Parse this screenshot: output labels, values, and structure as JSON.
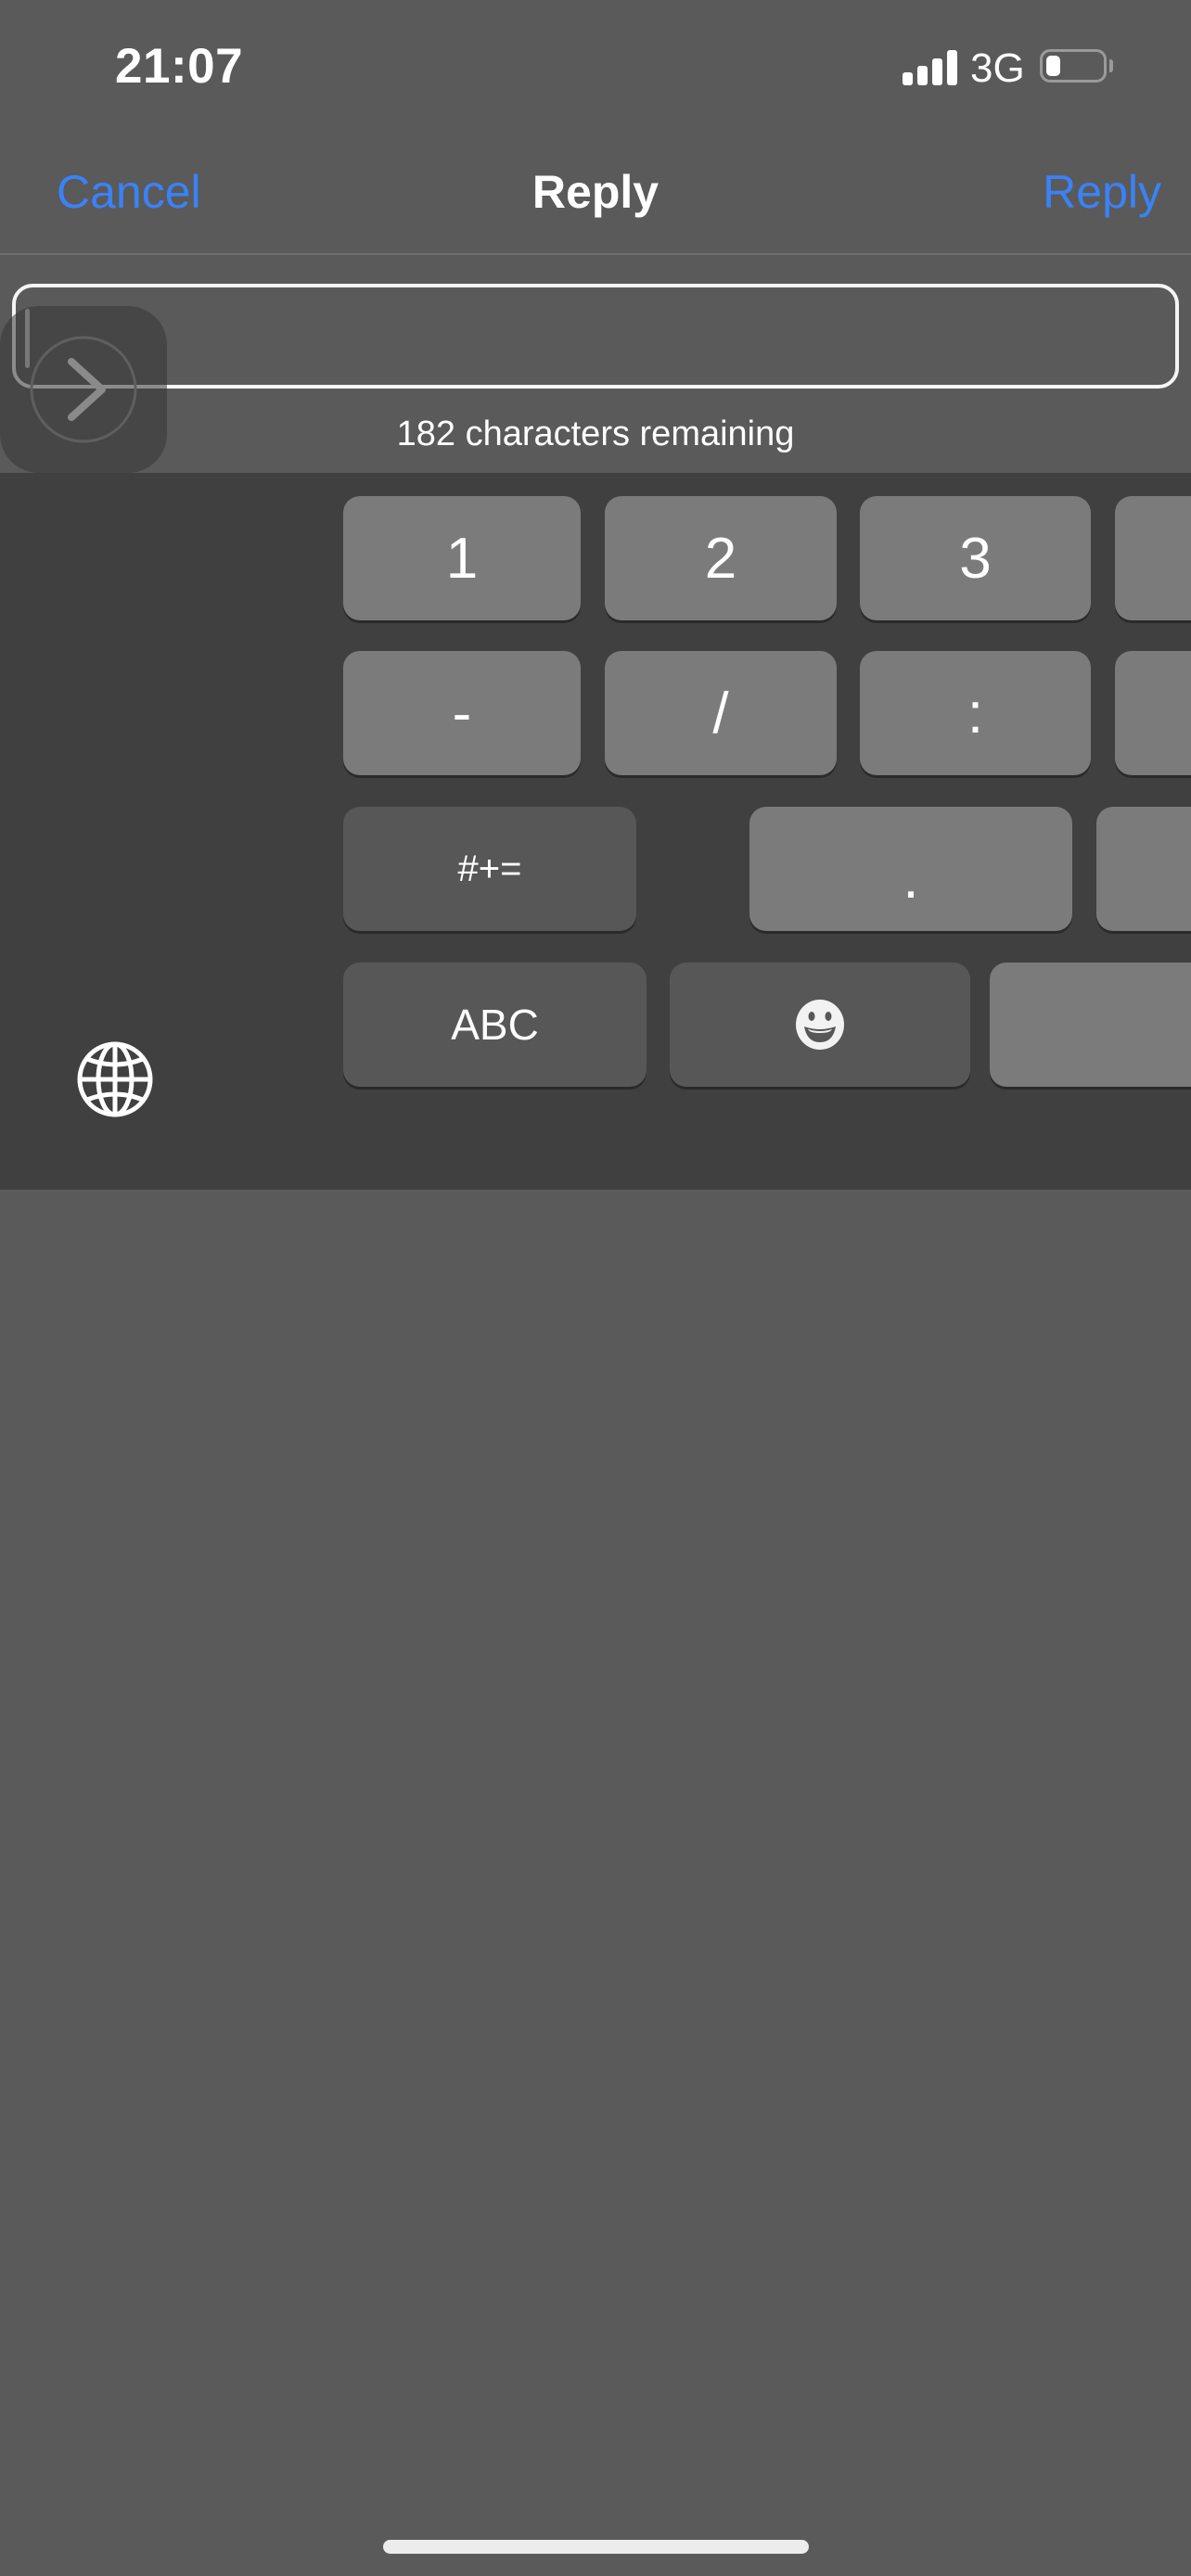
{
  "status_bar": {
    "time": "21:07",
    "network": "3G",
    "signal_bars": 4,
    "battery_level": 0.25
  },
  "nav": {
    "cancel_label": "Cancel",
    "title": "Reply",
    "reply_label": "Reply",
    "accent_color": "#3a82f7"
  },
  "compose": {
    "value": "",
    "placeholder": "",
    "counter": "182 characters remaining"
  },
  "assistive_touch": {
    "icon": "chevron-right-circle-icon"
  },
  "keyboard": {
    "row1": [
      "1",
      "2",
      "3",
      ""
    ],
    "row2": [
      "-",
      "/",
      ":",
      ""
    ],
    "row3": {
      "symbols_toggle": "#+=",
      "period": ".",
      "next": ""
    },
    "row4": {
      "abc": "ABC",
      "emoji": "emoji-icon",
      "space": ""
    },
    "globe": "globe-icon"
  }
}
